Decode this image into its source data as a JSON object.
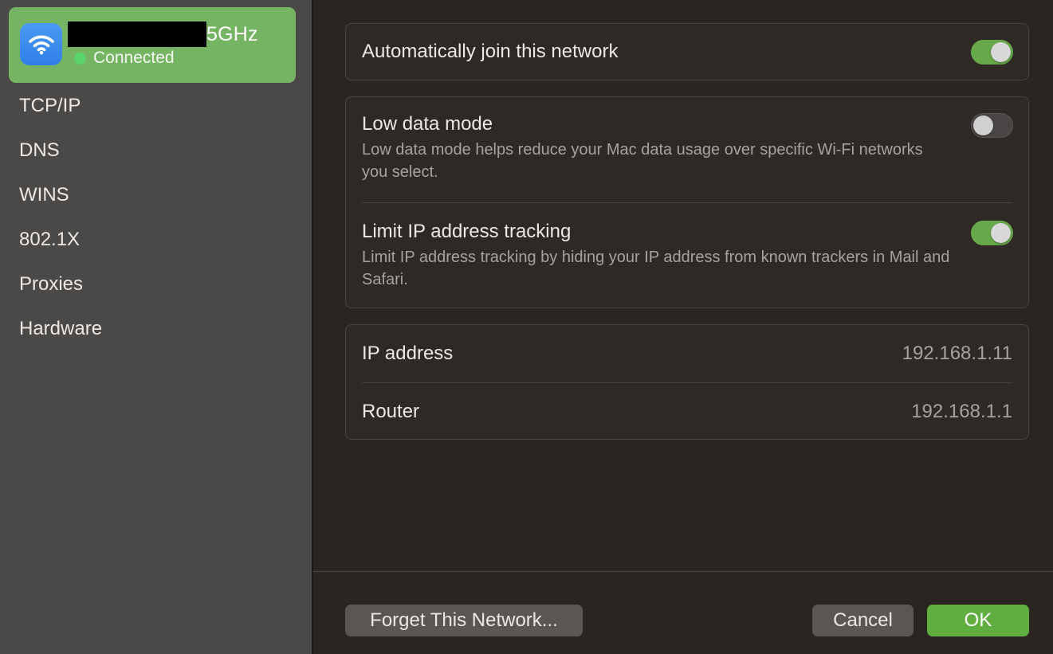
{
  "network": {
    "name_suffix": "5GHz",
    "status": "Connected",
    "icon": "wifi-icon"
  },
  "sidebar": {
    "items": [
      {
        "label": "TCP/IP"
      },
      {
        "label": "DNS"
      },
      {
        "label": "WINS"
      },
      {
        "label": "802.1X"
      },
      {
        "label": "Proxies"
      },
      {
        "label": "Hardware"
      }
    ]
  },
  "settings": {
    "auto_join": {
      "label": "Automatically join this network",
      "enabled": true
    },
    "low_data": {
      "label": "Low data mode",
      "description": "Low data mode helps reduce your Mac data usage over specific Wi-Fi networks you select.",
      "enabled": false
    },
    "limit_ip": {
      "label": "Limit IP address tracking",
      "description": "Limit IP address tracking by hiding your IP address from known trackers in Mail and Safari.",
      "enabled": true
    }
  },
  "info": {
    "ip_label": "IP address",
    "ip_value": "192.168.1.11",
    "router_label": "Router",
    "router_value": "192.168.1.1"
  },
  "buttons": {
    "forget": "Forget This Network...",
    "cancel": "Cancel",
    "ok": "OK"
  },
  "colors": {
    "selected_card": "#75b462",
    "toggle_on": "#66a84a",
    "ok_button": "#5fae3f",
    "status_dot": "#5bd46b"
  }
}
